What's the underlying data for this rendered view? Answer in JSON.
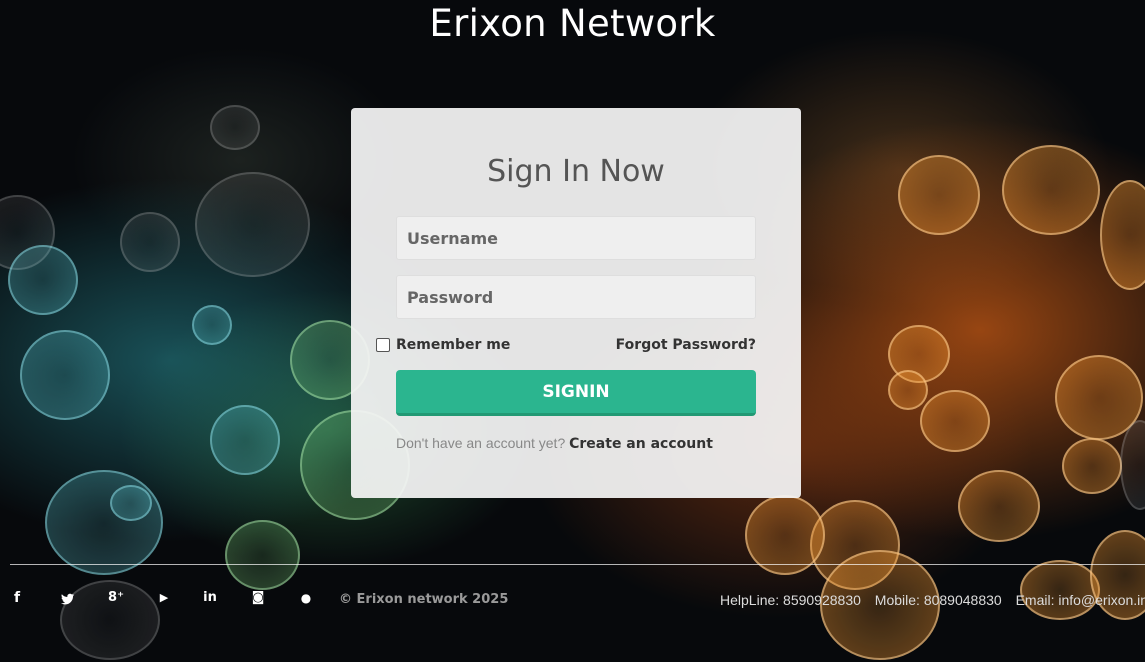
{
  "site": {
    "title": "Erixon Network"
  },
  "login": {
    "heading": "Sign In Now",
    "username_placeholder": "Username",
    "password_placeholder": "Password",
    "remember_label": "Remember me",
    "forgot_label": "Forgot Password?",
    "signin_label": "SIGNIN",
    "no_account_text": "Don't have an account yet?",
    "create_account_label": "Create an account"
  },
  "footer": {
    "social": [
      {
        "name": "facebook-icon",
        "glyph": "f"
      },
      {
        "name": "twitter-icon",
        "glyph": "🐦"
      },
      {
        "name": "google-plus-icon",
        "glyph": "8⁺"
      },
      {
        "name": "youtube-icon",
        "glyph": "▶"
      },
      {
        "name": "linkedin-icon",
        "glyph": "in"
      },
      {
        "name": "instagram-icon",
        "glyph": "◙"
      },
      {
        "name": "github-icon",
        "glyph": "●"
      }
    ],
    "copyright": "© Erixon network 2025",
    "helpline": "HelpLine: 8590928830",
    "mobile": "Mobile: 8089048830",
    "email": "Email: info@erixon.in"
  }
}
